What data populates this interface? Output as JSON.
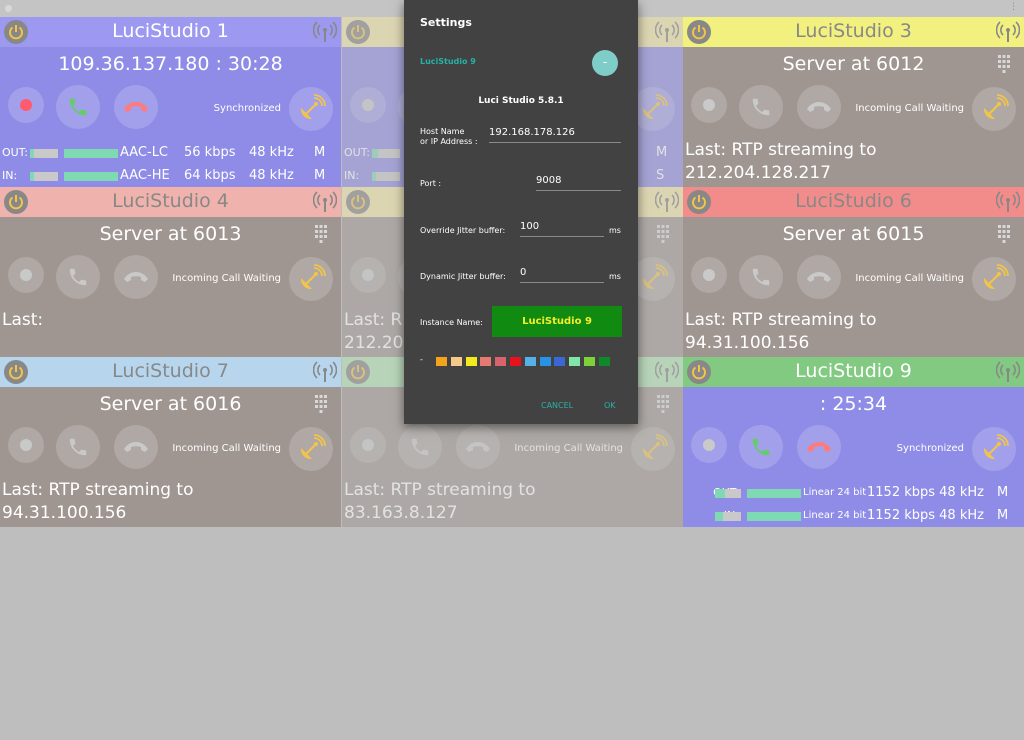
{
  "panels": [
    {
      "title": "LuciStudio 1",
      "header_color": "#9d99f0",
      "body_color": "#8e8ce6",
      "title_color": "#ffffff",
      "info": "109.36.137.180 : 30:28",
      "status": "Synchronized",
      "meters": [
        {
          "label": "OUT:",
          "codec": "AAC-LC",
          "kbps": "56 kbps",
          "khz": "48 kHz",
          "ch": "M",
          "level1": 0.15,
          "level2": 1.0
        },
        {
          "label": "IN:",
          "codec": "AAC-HE",
          "kbps": "64 kbps",
          "khz": "48 kHz",
          "ch": "M",
          "level1": 0.15,
          "level2": 1.0
        }
      ]
    },
    {
      "title": "",
      "header_color": "#f4e8a8",
      "body_color": "#8e8ce6",
      "title_color": "#ffffff",
      "info": "",
      "status": "",
      "meters": [
        {
          "label": "OUT:",
          "ch": "M",
          "level1": 0.2
        },
        {
          "label": "IN:",
          "ch": "S",
          "level1": 0.15
        }
      ]
    },
    {
      "title": "LuciStudio 3",
      "header_color": "#f2f07e",
      "body_color": "#9f9591",
      "title_color": "#888888",
      "info": "Server at 6012",
      "status": "Incoming Call Waiting",
      "last": [
        "Last: RTP streaming to",
        "212.204.128.217"
      ]
    },
    {
      "title": "LuciStudio 4",
      "header_color": "#f0b2ad",
      "body_color": "#9f9591",
      "title_color": "#888888",
      "info": "Server at 6013",
      "status": "Incoming Call Waiting",
      "last": [
        "Last:"
      ]
    },
    {
      "title": "",
      "header_color": "#f4e8a8",
      "body_color": "#9f9591",
      "title_color": "#888888",
      "info": "",
      "status": "",
      "last": [
        "Last: R",
        "212.20"
      ]
    },
    {
      "title": "LuciStudio 6",
      "header_color": "#f28c8a",
      "body_color": "#9f9591",
      "title_color": "#888888",
      "info": "Server at 6015",
      "status": "Incoming Call Waiting",
      "last": [
        "Last: RTP streaming to",
        "94.31.100.156"
      ]
    },
    {
      "title": "LuciStudio 7",
      "header_color": "#b7d6ee",
      "body_color": "#9f9591",
      "title_color": "#888888",
      "info": "Server at 6016",
      "status": "Incoming Call Waiting",
      "last": [
        "Last: RTP streaming to",
        "94.31.100.156"
      ]
    },
    {
      "title": "",
      "header_color": "#b3e6b3",
      "body_color": "#9f9591",
      "title_color": "#888888",
      "info": "",
      "status": "Incoming Call Waiting",
      "last": [
        "Last: RTP streaming to",
        "83.163.8.127"
      ]
    },
    {
      "title": "LuciStudio 9",
      "header_color": "#82c982",
      "body_color": "#8e8ce6",
      "title_color": "#ffffff",
      "info": ": 25:34",
      "status": "Synchronized",
      "meters": [
        {
          "label": "OUT:",
          "codec": "Linear 24 bit",
          "kbps": "1152 kbps 48 kHz",
          "ch": "M",
          "level1": 0.4,
          "level2": 1.0
        },
        {
          "label": "IN:",
          "codec": "Linear 24 bit",
          "kbps": "1152 kbps 48 kHz",
          "ch": "M",
          "level1": 0.3,
          "level2": 1.0
        }
      ]
    }
  ],
  "dialog": {
    "title": "Settings",
    "instance_label": "LuciStudio 9",
    "fab_label": "-",
    "version": "Luci Studio 5.8.1",
    "host_label_1": "Host Name",
    "host_label_2": "or IP Address :",
    "host_value": "192.168.178.126",
    "port_label": "Port :",
    "port_value": "9008",
    "override_label": "Override Jitter buffer:",
    "override_value": "100",
    "override_unit": "ms",
    "dynamic_label": "Dynamic Jitter buffer:",
    "dynamic_value": "0",
    "dynamic_unit": "ms",
    "instance_name_label": "Instance Name:",
    "instance_name_value": "LuciStudio 9",
    "color_dash": "-",
    "swatches": [
      "#f4a31b",
      "#f4c98a",
      "#f4ea1b",
      "#e57a70",
      "#d9636b",
      "#e8121c",
      "#56b2e6",
      "#2793e8",
      "#3a66d6",
      "#7fe6a8",
      "#7fd13a",
      "#0f8a2a"
    ],
    "cancel_label": "CANCEL",
    "ok_label": "OK",
    "accent": "#2bb0a8"
  }
}
